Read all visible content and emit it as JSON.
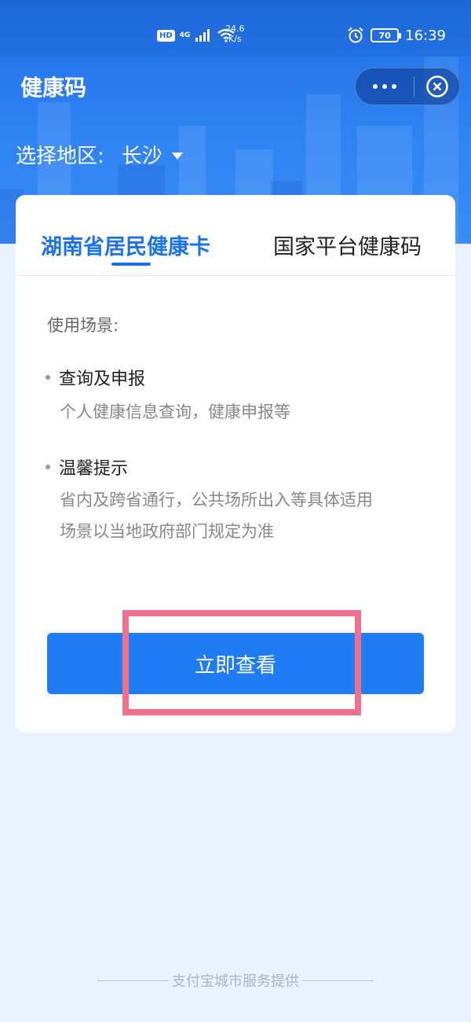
{
  "status_bar": {
    "hd_label": "HD",
    "network_label": "4G",
    "speed_value": "24.6",
    "speed_unit": "K/s",
    "battery_level": "70",
    "time": "16:39"
  },
  "title_bar": {
    "title": "健康码"
  },
  "region_selector": {
    "label": "选择地区:",
    "value": "长沙"
  },
  "tabs": [
    {
      "label": "湖南省居民健康卡",
      "active": true
    },
    {
      "label": "国家平台健康码",
      "active": false
    }
  ],
  "content": {
    "scene_label": "使用场景:",
    "items": [
      {
        "title": "查询及申报",
        "desc_lines": [
          "个人健康信息查询，健康申报等"
        ]
      },
      {
        "title": "温馨提示",
        "desc_lines": [
          "省内及跨省通行，公共场所出入等具体适用",
          "场景以当地政府部门规定为准"
        ]
      }
    ]
  },
  "action_button": {
    "label": "立即查看"
  },
  "footer": {
    "text": "支付宝城市服务提供"
  },
  "colors": {
    "header_blue": "#2270e2",
    "primary": "#1f7cf2",
    "tab_active": "#1a73e8",
    "highlight": "#f0708f",
    "page_background": "#e8f1fd"
  }
}
